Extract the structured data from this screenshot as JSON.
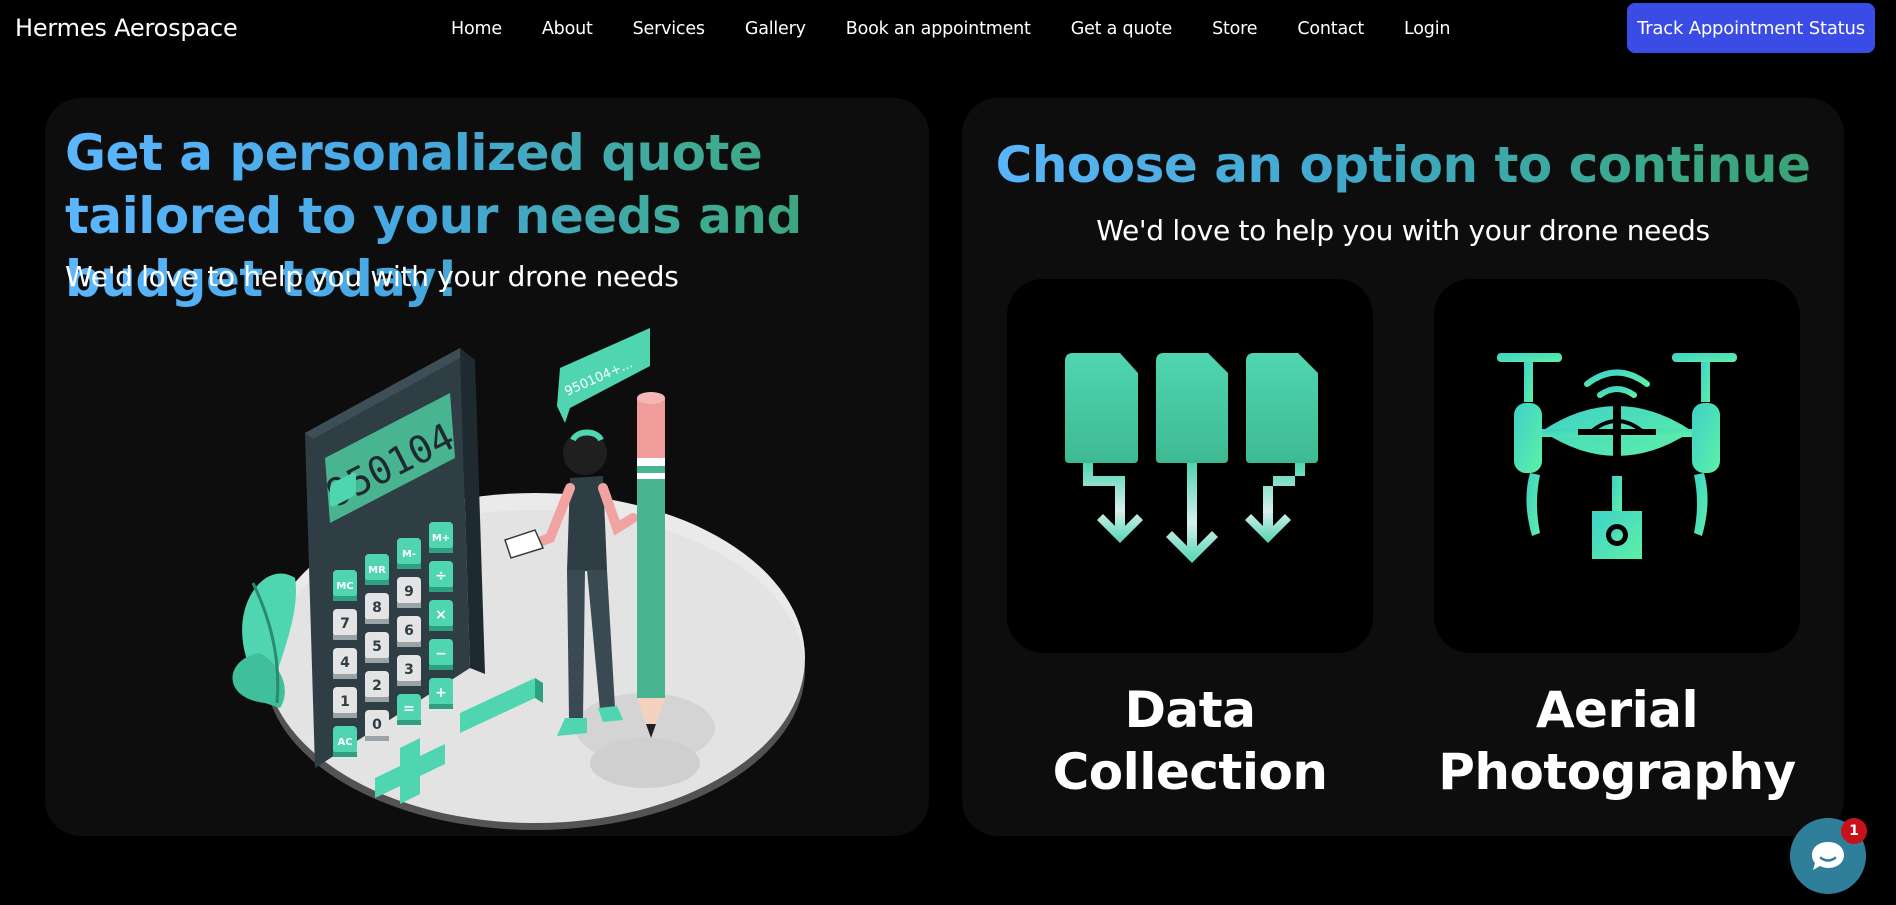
{
  "header": {
    "brand": "Hermes Aerospace",
    "nav": [
      {
        "label": "Home"
      },
      {
        "label": "About"
      },
      {
        "label": "Services"
      },
      {
        "label": "Gallery"
      },
      {
        "label": "Book an appointment"
      },
      {
        "label": "Get a quote"
      },
      {
        "label": "Store"
      },
      {
        "label": "Contact"
      },
      {
        "label": "Login"
      }
    ],
    "track_button": "Track Appointment Status"
  },
  "quote_panel": {
    "headline": "Get a personalized quote tailored to your needs and budget today!",
    "subtitle": "We'd love to help you with your drone needs",
    "illustration": {
      "calculator_display": "950104",
      "speech_bubble": "950104+...",
      "keys": [
        "MC",
        "MR",
        "M-",
        "M+",
        "7",
        "8",
        "9",
        "÷",
        "4",
        "5",
        "6",
        "×",
        "1",
        "2",
        "3",
        "−",
        "AC",
        "0",
        "=",
        "+"
      ]
    }
  },
  "options_panel": {
    "title": "Choose an option to continue",
    "subtitle": "We'd love to help you with your drone needs",
    "options": [
      {
        "label": "Data Collection",
        "icon": "data-collection-icon"
      },
      {
        "label": "Aerial Photography",
        "icon": "drone-camera-icon"
      }
    ]
  },
  "chat_widget": {
    "icon": "chat-bubble-icon",
    "badge": "1"
  },
  "colors": {
    "accent_button": "#3b4ce6",
    "gradient_start": "#5cb6ff",
    "gradient_end": "#3aa070",
    "teal": "#4fd6b0",
    "badge": "#c9111b"
  }
}
